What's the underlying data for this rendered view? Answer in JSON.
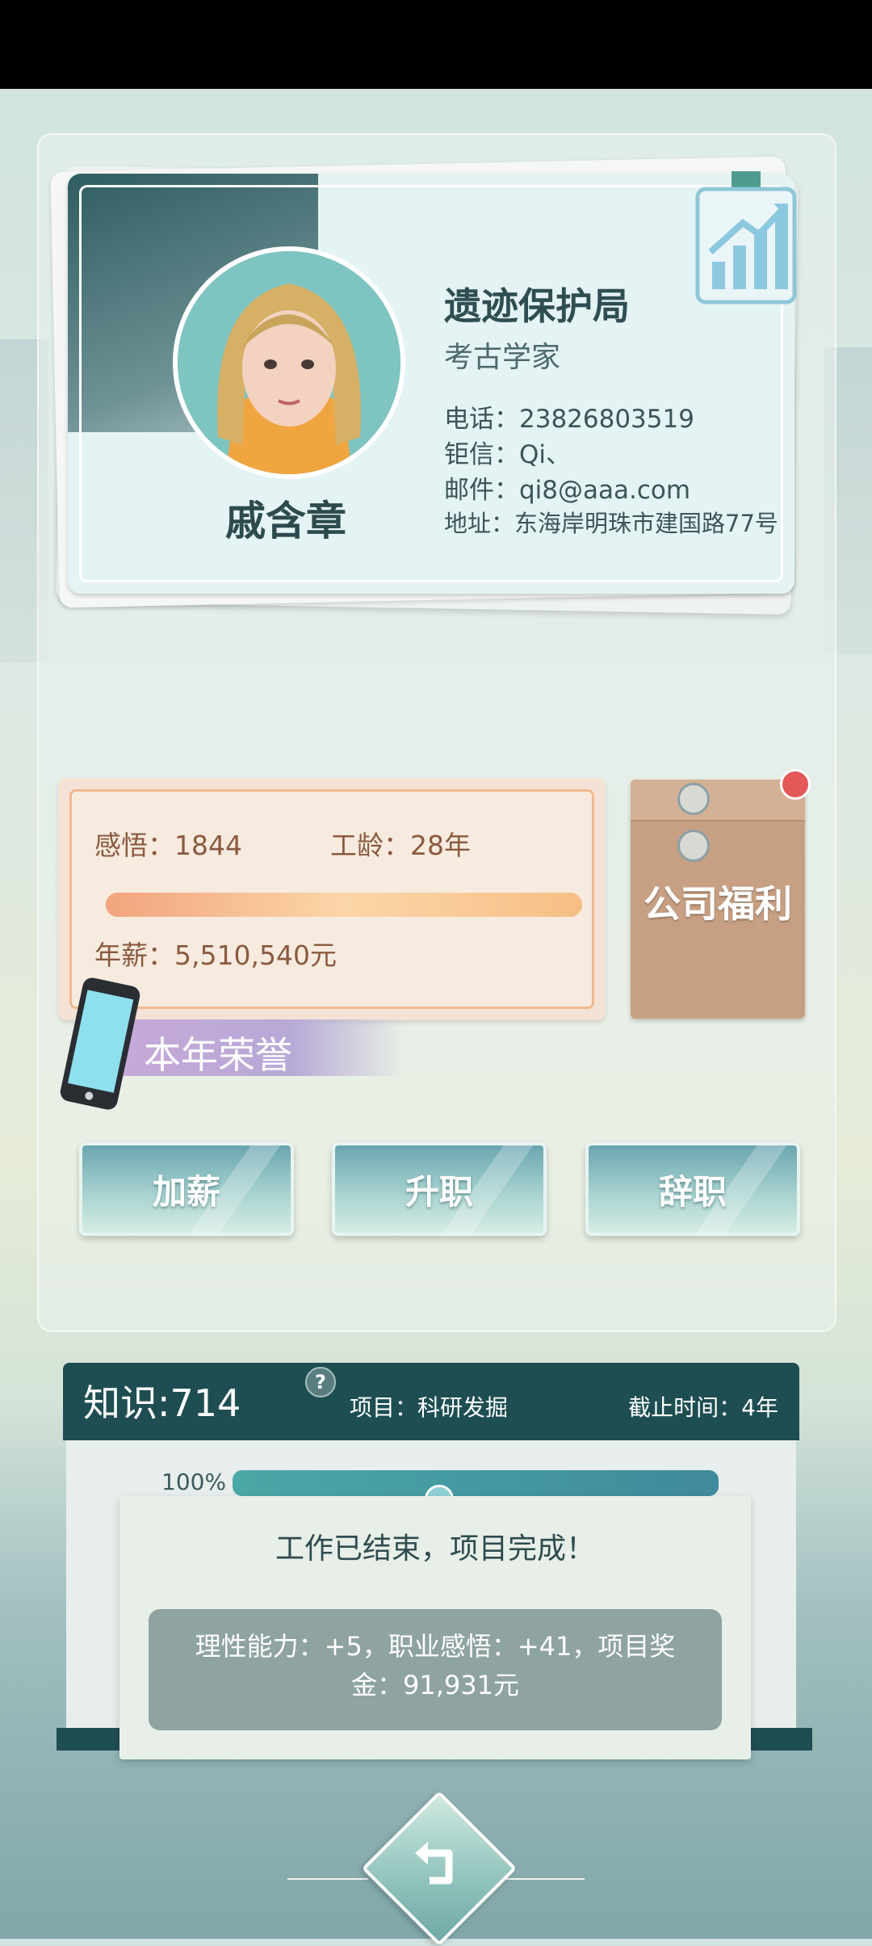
{
  "profile": {
    "name": "戚含章",
    "organization": "遗迹保护局",
    "job_title": "考古学家",
    "phone": "电话：23826803519",
    "pager": "钜信：Qi、",
    "email": "邮件：qi8@aaa.com",
    "address": "地址：东海岸明珠市建国路77号"
  },
  "stats": {
    "insight": "感悟：1844",
    "seniority": "工龄：28年",
    "salary": "年薪：5,510,540元",
    "progress_percent": 100
  },
  "benefits": {
    "label": "公司福利"
  },
  "honor": {
    "label": "本年荣誉"
  },
  "actions": [
    {
      "label": "加薪"
    },
    {
      "label": "升职"
    },
    {
      "label": "辞职"
    }
  ],
  "project": {
    "knowledge": "知识:714",
    "help": "?",
    "name": "项目：科研发掘",
    "deadline": "截止时间：4年",
    "percent_label": "100%",
    "progress_percent": 100
  },
  "dialog": {
    "title": "工作已结束，项目完成！",
    "result": "理性能力：+5，职业感悟：+41，项目奖金：91,931元"
  },
  "colors": {
    "accent_teal": "#1e4e52",
    "progress_orange": "#f2a47e",
    "notification_red": "#e35858"
  },
  "icons": {
    "growth_chart": "growth-chart-icon",
    "phone": "phone-icon",
    "back": "back-arrow-icon",
    "help": "help-icon"
  }
}
